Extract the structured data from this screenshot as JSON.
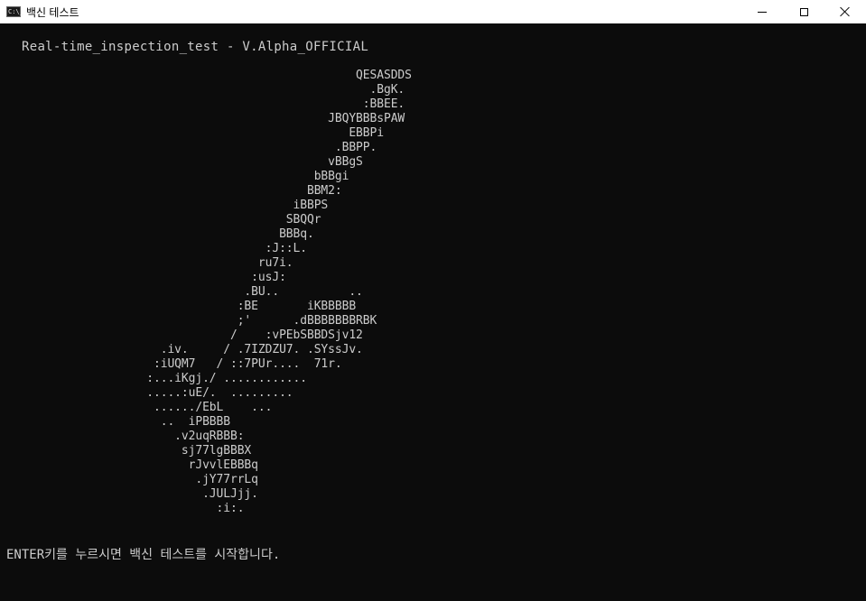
{
  "window": {
    "icon_label": "C:\\_",
    "title": "백신 테스트",
    "minimize_icon": "minimize-icon",
    "maximize_icon": "maximize-icon",
    "close_icon": "close-icon"
  },
  "console": {
    "header": "Real-time_inspection_test - V.Alpha_OFFICIAL",
    "art_lines": [
      "                                                   QESASDDS",
      "                                                     .BgK.",
      "                                                    :BBEE.",
      "                                               JBQYBBBsPAW",
      "                                                  EBBPi",
      "                                                .BBPP.",
      "                                               vBBgS",
      "                                             bBBgi",
      "                                            BBM2:",
      "                                          iBBPS",
      "                                         SBQQr",
      "                                        BBBq.",
      "                                      :J::L.",
      "                                     ru7i.",
      "                                    :usJ:",
      "                                   .BU..          ..",
      "                                  :BE       iKBBBBB",
      "                                  ;'      .dBBBBBBBRBK",
      "                                 /    :vPEbSBBDSjv12",
      "                       .iv.     / .7IZDZU7. .SYssJv.",
      "                      :iUQM7   / ::7PUr....  71r.",
      "                     :...iKgj./ ............",
      "                     .....:uE/.  .........",
      "                      ....../EbL    ...",
      "                       ..  iPBBBB",
      "                         .v2uqRBBB:",
      "                          sj77lgBBBX",
      "                           rJvvlEBBBq",
      "                            .jY77rrLq",
      "                             .JULJjj.",
      "                               :i:."
    ],
    "prompt": "ENTER키를 누르시면 백신 테스트를 시작합니다."
  }
}
